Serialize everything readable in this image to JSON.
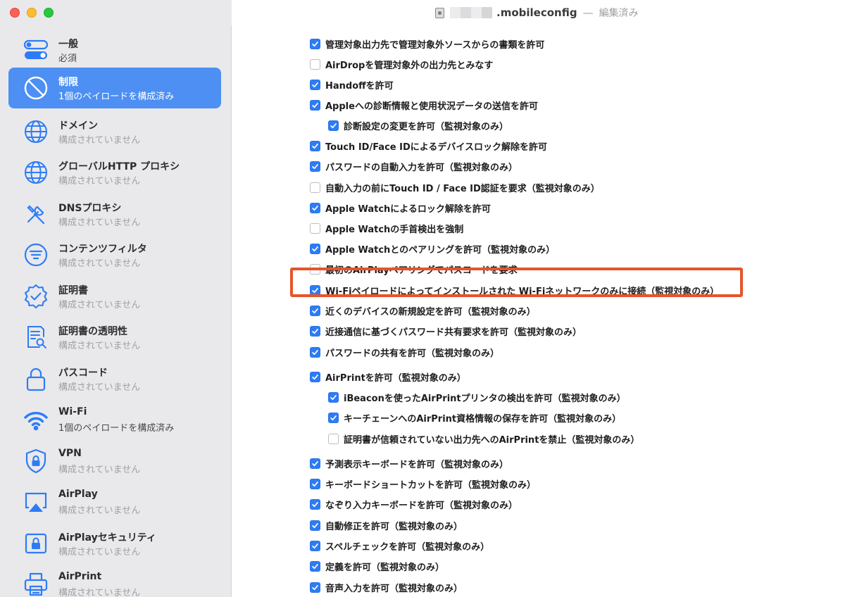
{
  "window": {
    "title": ".mobileconfig",
    "separator": "—",
    "status": "編集済み"
  },
  "colors": {
    "accent": "#2d7cf6",
    "sidebar_selected": "#4d8ff2",
    "highlight_border": "#e7542a"
  },
  "sidebar": {
    "items": [
      {
        "title": "一般",
        "subtitle": "必須",
        "icon": "toggles-icon"
      },
      {
        "title": "制限",
        "subtitle": "1個のペイロードを構成済み",
        "icon": "restriction-icon",
        "selected": true
      },
      {
        "title": "ドメイン",
        "subtitle": "構成されていません",
        "icon": "globe-icon"
      },
      {
        "title": "グローバルHTTP プロキシ",
        "subtitle": "構成されていません",
        "icon": "globe-icon"
      },
      {
        "title": "DNSプロキシ",
        "subtitle": "構成されていません",
        "icon": "tools-icon"
      },
      {
        "title": "コンテンツフィルタ",
        "subtitle": "構成されていません",
        "icon": "filter-icon"
      },
      {
        "title": "証明書",
        "subtitle": "構成されていません",
        "icon": "certificate-badge-icon"
      },
      {
        "title": "証明書の透明性",
        "subtitle": "構成されていません",
        "icon": "document-search-icon"
      },
      {
        "title": "パスコード",
        "subtitle": "構成されていません",
        "icon": "lock-icon"
      },
      {
        "title": "Wi-Fi",
        "subtitle": "1個のペイロードを構成済み",
        "icon": "wifi-icon"
      },
      {
        "title": "VPN",
        "subtitle": "構成されていません",
        "icon": "vpn-shield-icon"
      },
      {
        "title": "AirPlay",
        "subtitle": "構成されていません",
        "icon": "airplay-icon"
      },
      {
        "title": "AirPlayセキュリティ",
        "subtitle": "構成されていません",
        "icon": "airplay-lock-icon"
      },
      {
        "title": "AirPrint",
        "subtitle": "構成されていません",
        "icon": "printer-icon"
      }
    ]
  },
  "options": [
    {
      "label": "管理対象出力先で管理対象外ソースからの書類を許可",
      "checked": true
    },
    {
      "label": "AirDropを管理対象外の出力先とみなす",
      "checked": false
    },
    {
      "label": "Handoffを許可",
      "checked": true
    },
    {
      "label": "Appleへの診断情報と使用状況データの送信を許可",
      "checked": true
    },
    {
      "label": "診断設定の変更を許可（監視対象のみ）",
      "checked": true
    },
    {
      "label": "Touch ID/Face IDによるデバイスロック解除を許可",
      "checked": true
    },
    {
      "label": "パスワードの自動入力を許可（監視対象のみ）",
      "checked": true
    },
    {
      "label": "自動入力の前にTouch ID / Face ID認証を要求（監視対象のみ）",
      "checked": false
    },
    {
      "label": "Apple Watchによるロック解除を許可",
      "checked": true
    },
    {
      "label": "Apple Watchの手首検出を強制",
      "checked": false
    },
    {
      "label": "Apple Watchとのペアリングを許可（監視対象のみ）",
      "checked": true
    },
    {
      "label": "最初のAirPlayペアリングでパスコードを要求",
      "checked": false
    },
    {
      "label": "Wi-Fiペイロードによってインストールされた Wi-Fiネットワークのみに接続（監視対象のみ）",
      "checked": true
    },
    {
      "label": "近くのデバイスの新規設定を許可（監視対象のみ）",
      "checked": true
    },
    {
      "label": "近接通信に基づくパスワード共有要求を許可（監視対象のみ）",
      "checked": true
    },
    {
      "label": "パスワードの共有を許可（監視対象のみ）",
      "checked": true
    },
    {
      "label": "AirPrintを許可（監視対象のみ）",
      "checked": true
    },
    {
      "label": "iBeaconを使ったAirPrintプリンタの検出を許可（監視対象のみ）",
      "checked": true
    },
    {
      "label": "キーチェーンへのAirPrint資格情報の保存を許可（監視対象のみ）",
      "checked": true
    },
    {
      "label": "証明書が信頼されていない出力先へのAirPrintを禁止（監視対象のみ）",
      "checked": false
    },
    {
      "label": "予測表示キーボードを許可（監視対象のみ）",
      "checked": true
    },
    {
      "label": "キーボードショートカットを許可（監視対象のみ）",
      "checked": true
    },
    {
      "label": "なぞり入力キーボードを許可（監視対象のみ）",
      "checked": true
    },
    {
      "label": "自動修正を許可（監視対象のみ）",
      "checked": true
    },
    {
      "label": "スペルチェックを許可（監視対象のみ）",
      "checked": true
    },
    {
      "label": "定義を許可（監視対象のみ）",
      "checked": true
    },
    {
      "label": "音声入力を許可（監視対象のみ）",
      "checked": true
    }
  ]
}
